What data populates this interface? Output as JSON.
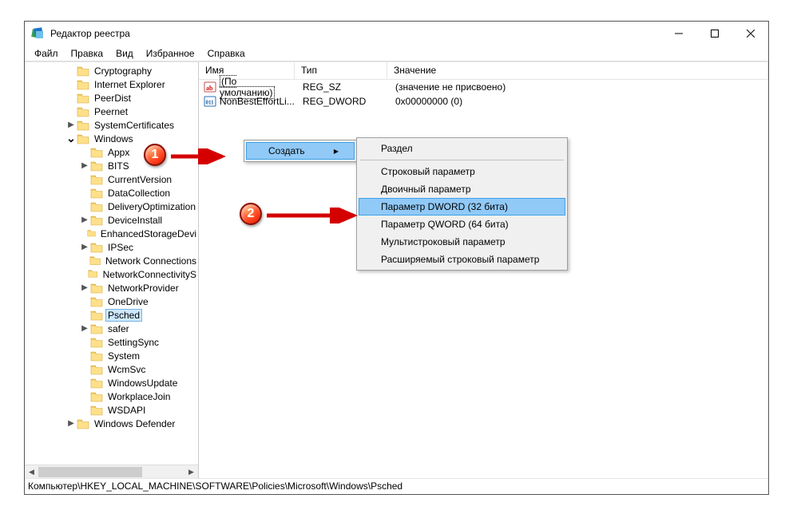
{
  "window": {
    "title": "Редактор реестра"
  },
  "menubar": {
    "items": [
      "Файл",
      "Правка",
      "Вид",
      "Избранное",
      "Справка"
    ]
  },
  "tree": {
    "nodes": [
      {
        "indent": 3,
        "expander": "",
        "label": "Cryptography"
      },
      {
        "indent": 3,
        "expander": "",
        "label": "Internet Explorer"
      },
      {
        "indent": 3,
        "expander": "",
        "label": "PeerDist"
      },
      {
        "indent": 3,
        "expander": "",
        "label": "Peernet"
      },
      {
        "indent": 3,
        "expander": ">",
        "label": "SystemCertificates"
      },
      {
        "indent": 3,
        "expander": "v",
        "label": "Windows"
      },
      {
        "indent": 4,
        "expander": "",
        "label": "Appx"
      },
      {
        "indent": 4,
        "expander": ">",
        "label": "BITS"
      },
      {
        "indent": 4,
        "expander": "",
        "label": "CurrentVersion"
      },
      {
        "indent": 4,
        "expander": "",
        "label": "DataCollection"
      },
      {
        "indent": 4,
        "expander": "",
        "label": "DeliveryOptimization"
      },
      {
        "indent": 4,
        "expander": ">",
        "label": "DeviceInstall"
      },
      {
        "indent": 4,
        "expander": "",
        "label": "EnhancedStorageDevi"
      },
      {
        "indent": 4,
        "expander": ">",
        "label": "IPSec"
      },
      {
        "indent": 4,
        "expander": "",
        "label": "Network Connections"
      },
      {
        "indent": 4,
        "expander": "",
        "label": "NetworkConnectivityS"
      },
      {
        "indent": 4,
        "expander": ">",
        "label": "NetworkProvider"
      },
      {
        "indent": 4,
        "expander": "",
        "label": "OneDrive"
      },
      {
        "indent": 4,
        "expander": "",
        "label": "Psched",
        "selected": true
      },
      {
        "indent": 4,
        "expander": ">",
        "label": "safer"
      },
      {
        "indent": 4,
        "expander": "",
        "label": "SettingSync"
      },
      {
        "indent": 4,
        "expander": "",
        "label": "System"
      },
      {
        "indent": 4,
        "expander": "",
        "label": "WcmSvc"
      },
      {
        "indent": 4,
        "expander": "",
        "label": "WindowsUpdate"
      },
      {
        "indent": 4,
        "expander": "",
        "label": "WorkplaceJoin"
      },
      {
        "indent": 4,
        "expander": "",
        "label": "WSDAPI"
      },
      {
        "indent": 3,
        "expander": ">",
        "label": "Windows Defender"
      }
    ]
  },
  "list": {
    "columns": {
      "name": "Имя",
      "type": "Тип",
      "value": "Значение"
    },
    "rows": [
      {
        "icon": "sz",
        "name": "(По умолчанию)",
        "default": true,
        "type": "REG_SZ",
        "value": "(значение не присвоено)"
      },
      {
        "icon": "dw",
        "name": "NonBestEffortLi...",
        "type": "REG_DWORD",
        "value": "0x00000000 (0)"
      }
    ]
  },
  "contextmenu": {
    "create_label": "Создать",
    "sub": {
      "section": "Раздел",
      "string": "Строковый параметр",
      "binary": "Двоичный параметр",
      "dword": "Параметр DWORD (32 бита)",
      "qword": "Параметр QWORD (64 бита)",
      "multi": "Мультистроковый параметр",
      "expand": "Расширяемый строковый параметр"
    }
  },
  "statusbar": {
    "path": "Компьютер\\HKEY_LOCAL_MACHINE\\SOFTWARE\\Policies\\Microsoft\\Windows\\Psched"
  },
  "annotations": {
    "marker1": "1",
    "marker2": "2"
  }
}
